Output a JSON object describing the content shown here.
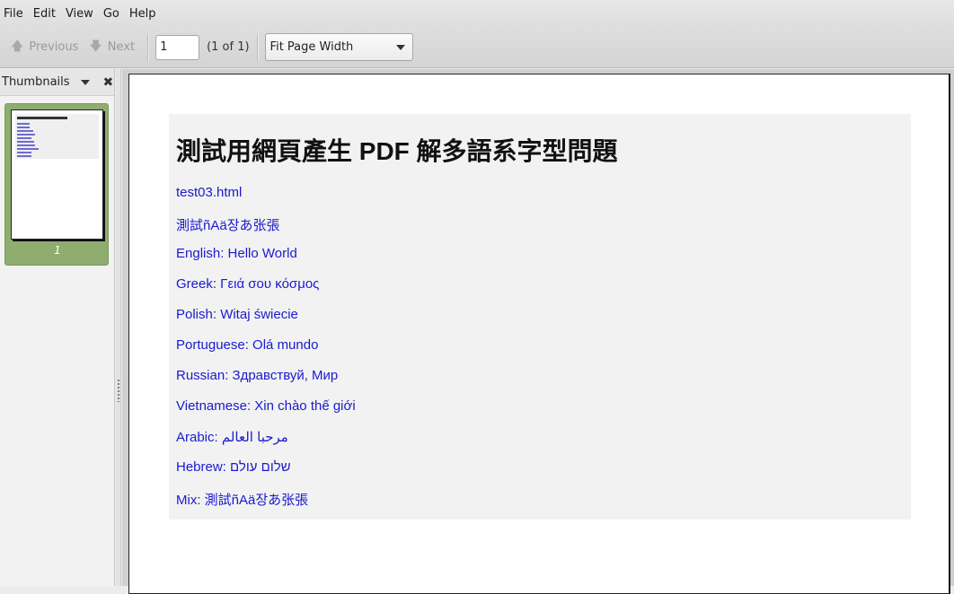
{
  "menu": [
    "File",
    "Edit",
    "View",
    "Go",
    "Help"
  ],
  "toolbar": {
    "previous_label": "Previous",
    "next_label": "Next",
    "page_value": "1",
    "page_count": "(1 of 1)",
    "zoom_value": "Fit Page Width"
  },
  "sidebar": {
    "title": "Thumbnails",
    "thumbnail_label": "1"
  },
  "document": {
    "title": "測試用網頁產生 PDF 解多語系字型問題",
    "links": [
      "test03.html",
      "測試ñAä장あ张張",
      "English: Hello World",
      "Greek: Γειά σου κόσμος",
      "Polish: Witaj świecie",
      "Portuguese: Olá mundo",
      "Russian: Здравствуй, Мир",
      "Vietnamese: Xin chào thế giới",
      "Arabic: مرحبا العالم",
      "Hebrew: שלום עולם",
      "Mix: 測試ñAä장あ张張"
    ]
  },
  "colors": {
    "link": "#1a1ad0",
    "thumbnail_selected": "#8fad6f"
  }
}
